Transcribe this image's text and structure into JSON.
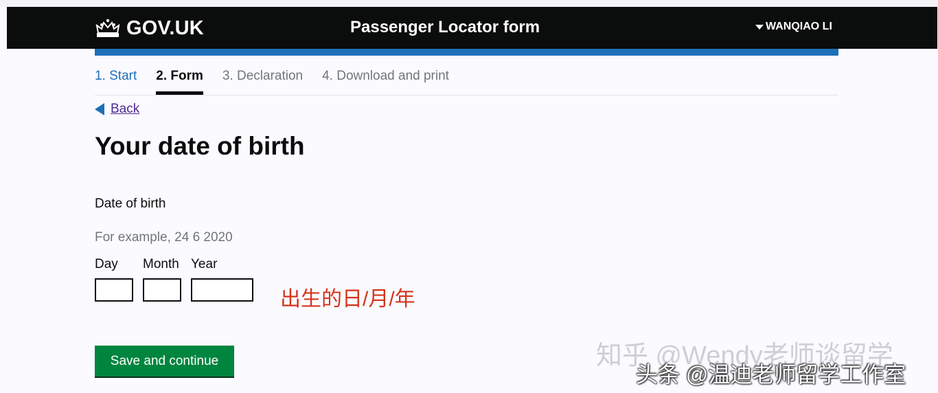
{
  "header": {
    "brand": "GOV.UK",
    "service_name": "Passenger Locator form",
    "account_name": "WANQIAO LI",
    "brand_color": "#0b0c0c",
    "accent_color": "#1d70b8"
  },
  "steps": [
    {
      "label": "1. Start",
      "state": "done"
    },
    {
      "label": "2. Form",
      "state": "current"
    },
    {
      "label": "3. Declaration",
      "state": "upcoming"
    },
    {
      "label": "4. Download and print",
      "state": "upcoming"
    }
  ],
  "back_link": "Back",
  "page_title": "Your date of birth",
  "form": {
    "label": "Date of birth",
    "hint": "For example, 24 6 2020",
    "day_label": "Day",
    "month_label": "Month",
    "year_label": "Year",
    "day_value": "",
    "month_value": "",
    "year_value": ""
  },
  "annotation": "出生的日/月/年",
  "annotation_color": "#d4351c",
  "submit_label": "Save and continue",
  "submit_color": "#00853f",
  "watermarks": {
    "zhihu": "知乎 @Wendy老师谈留学",
    "toutiao": "头条 @温迪老师留学工作室"
  }
}
